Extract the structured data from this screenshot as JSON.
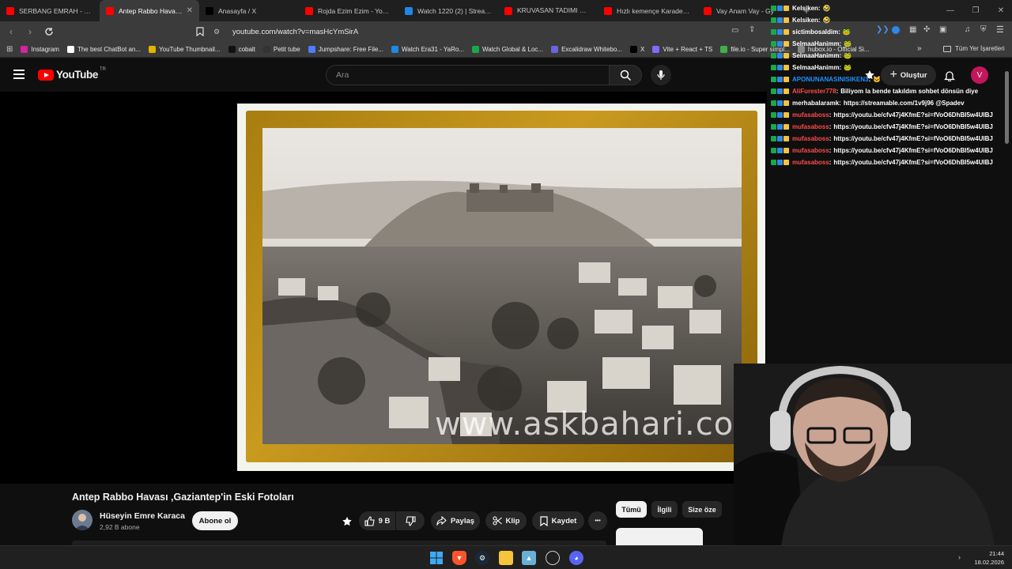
{
  "browser": {
    "tabs": [
      {
        "label": "SERBANG EMRAH - ÇİVİLE",
        "color": "#ff0000",
        "active": false
      },
      {
        "label": "Antep Rabbo Havası ,Ga",
        "color": "#ff0000",
        "active": true
      },
      {
        "label": "Anasayfa / X",
        "color": "#000000",
        "active": false
      },
      {
        "label": "Rojda Ezim Ezim - YouTube",
        "color": "#ff0000",
        "active": false
      },
      {
        "label": "Watch 1220 (2) | Streamab",
        "color": "#1e88e5",
        "active": false
      },
      {
        "label": "KRUVASAN TADIMI 🥐 EV",
        "color": "#ff0000",
        "active": false
      },
      {
        "label": "Hızlı kemençe Karadeniz H",
        "color": "#ff0000",
        "active": false
      },
      {
        "label": "Vay Anam Vay - Gy",
        "color": "#ff0000",
        "active": false
      }
    ],
    "active_tab_close": "✕",
    "new_tab": "+",
    "url": "youtube.com/watch?v=masHcYmSirA",
    "bookmarks": [
      {
        "label": "Instagram",
        "color": "#d6249f"
      },
      {
        "label": "The best ChatBot an...",
        "color": "#ffffff"
      },
      {
        "label": "YouTube Thumbnail...",
        "color": "#e5b400"
      },
      {
        "label": "cobalt",
        "color": "#111111"
      },
      {
        "label": "Petit tube",
        "color": "#333333"
      },
      {
        "label": "Jumpshare: Free File...",
        "color": "#4d7cfe"
      },
      {
        "label": "Watch Era31 - YaRo...",
        "color": "#1e88e5"
      },
      {
        "label": "Watch Global & Loc...",
        "color": "#1aa84b"
      },
      {
        "label": "Excalidraw Whitebo...",
        "color": "#6965db"
      },
      {
        "label": "X",
        "color": "#000000"
      },
      {
        "label": "Vite + React + TS",
        "color": "#7e6cff"
      },
      {
        "label": "file.io - Super simpl...",
        "color": "#3fb04a"
      },
      {
        "label": "hubox.io - Official Si...",
        "color": "#888888"
      }
    ],
    "bookmarks_more": "»",
    "all_bookmarks": "Tüm Yer İşaretleri"
  },
  "youtube": {
    "logo_text": "YouTube",
    "country_code": "TR",
    "search_placeholder": "Ara",
    "create_label": "Oluştur",
    "avatar_letter": "V",
    "video_title": "Antep Rabbo Havası ,Gaziantep'in Eski Fotoları",
    "channel_name": "Hüseyin Emre Karaca",
    "subscribers": "2,92 B abone",
    "subscribe_label": "Abone ol",
    "like_count": "9 B",
    "share_label": "Paylaş",
    "clip_label": "Klip",
    "save_label": "Kaydet",
    "more_label": "•••",
    "watermark": "www.askbahari.com",
    "chips": [
      "Tümü",
      "İlgili",
      "Size öze"
    ]
  },
  "chat": [
    {
      "user": "Kelsiken",
      "message": "🤣",
      "color": "#ffffff"
    },
    {
      "user": "Kelsiken",
      "message": "🤣",
      "color": "#ffffff"
    },
    {
      "user": "sictimbosaldim",
      "message": "🐸",
      "color": "#ffffff"
    },
    {
      "user": "SelmaaHanimm",
      "message": "🐸",
      "color": "#ffffff"
    },
    {
      "user": "SelmaaHanimm",
      "message": "🐸",
      "color": "#ffffff"
    },
    {
      "user": "SelmaaHanimm",
      "message": "🐸",
      "color": "#ffffff"
    },
    {
      "user": "APONUNANASINISIKEN3",
      "message": "🐱",
      "color": "#1e90ff"
    },
    {
      "user": "AliFurester778",
      "message": "Biliyom la bende takıldım sohbet dönsün diye",
      "color": "#ff4b4b"
    },
    {
      "user": "merhabalaramk",
      "message": "https://streamable.com/1v9j96 @Spadev",
      "color": "#ffffff"
    },
    {
      "user": "mufasaboss",
      "message": "https://youtu.be/cfv47j4KfmE?si=fVoO6DhBI5w4UIBJ",
      "color": "#ff4b4b"
    },
    {
      "user": "mufasaboss",
      "message": "https://youtu.be/cfv47j4KfmE?si=fVoO6DhBI5w4UIBJ",
      "color": "#ff4b4b"
    },
    {
      "user": "mufasaboss",
      "message": "https://youtu.be/cfv47j4KfmE?si=fVoO6DhBI5w4UIBJ",
      "color": "#ff4b4b"
    },
    {
      "user": "mufasaboss",
      "message": "https://youtu.be/cfv47j4KfmE?si=fVoO6DhBI5w4UIBJ",
      "color": "#ff4b4b"
    },
    {
      "user": "mufasaboss",
      "message": "https://youtu.be/cfv47j4KfmE?si=fVoO6DhBI5w4UIBJ",
      "color": "#ff4b4b"
    }
  ],
  "taskbar": {
    "time": "21:44",
    "date": "18.02.2026"
  }
}
